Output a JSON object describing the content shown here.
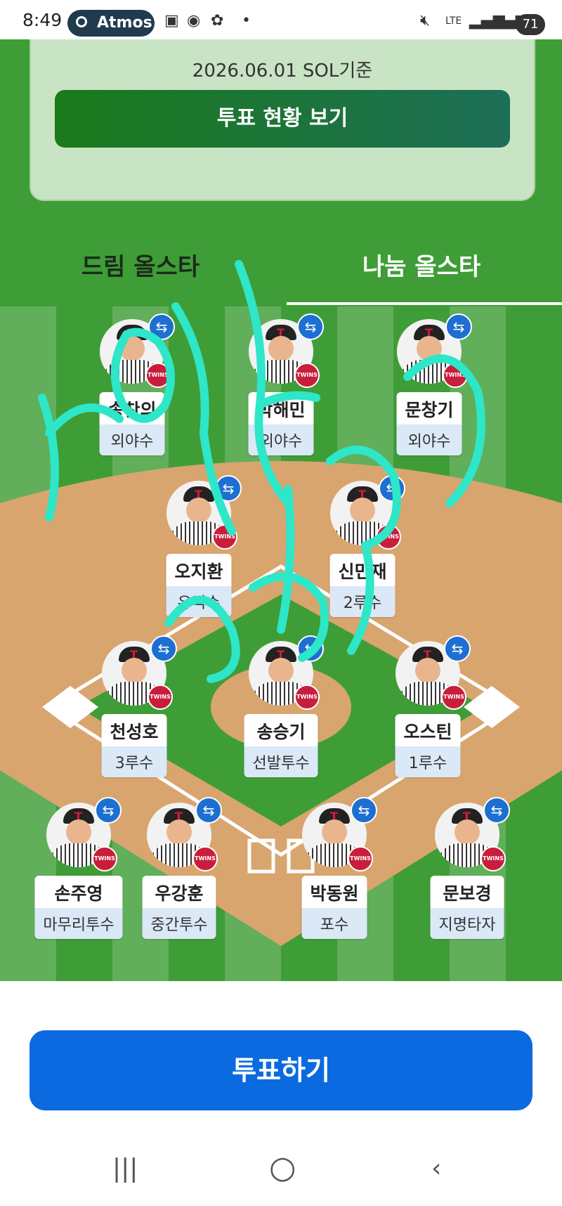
{
  "status_bar": {
    "time": "8:49",
    "app_pill": "Atmos",
    "network": "LTE",
    "battery": "71"
  },
  "vote_card": {
    "date_text": "2026.06.01 SOL기준",
    "status_button": "투표 현황 보기"
  },
  "tabs": [
    {
      "label": "드림 올스타",
      "active": false
    },
    {
      "label": "나눔 올스타",
      "active": true
    }
  ],
  "players": {
    "lf": {
      "name": "송찬의",
      "position": "외야수"
    },
    "cf": {
      "name": "박해민",
      "position": "외야수"
    },
    "rf": {
      "name": "문창기",
      "position": "외야수"
    },
    "ss": {
      "name": "오지환",
      "position": "유격수"
    },
    "second": {
      "name": "신민재",
      "position": "2루수"
    },
    "third": {
      "name": "천성호",
      "position": "3루수"
    },
    "sp": {
      "name": "송승기",
      "position": "선발투수"
    },
    "first": {
      "name": "오스틴",
      "position": "1루수"
    },
    "cl": {
      "name": "손주영",
      "position": "마무리투수"
    },
    "rp": {
      "name": "우강훈",
      "position": "중간투수"
    },
    "c": {
      "name": "박동원",
      "position": "포수"
    },
    "dh": {
      "name": "문보경",
      "position": "지명타자"
    }
  },
  "team_badge": "TWINS",
  "swap_glyph": "⇆",
  "vote_button": "투표하기",
  "colors": {
    "field_green": "#3d9a36",
    "dirt": "#d9a56f",
    "vote_blue": "#0b6ae0",
    "scribble": "#2ee6c8"
  }
}
